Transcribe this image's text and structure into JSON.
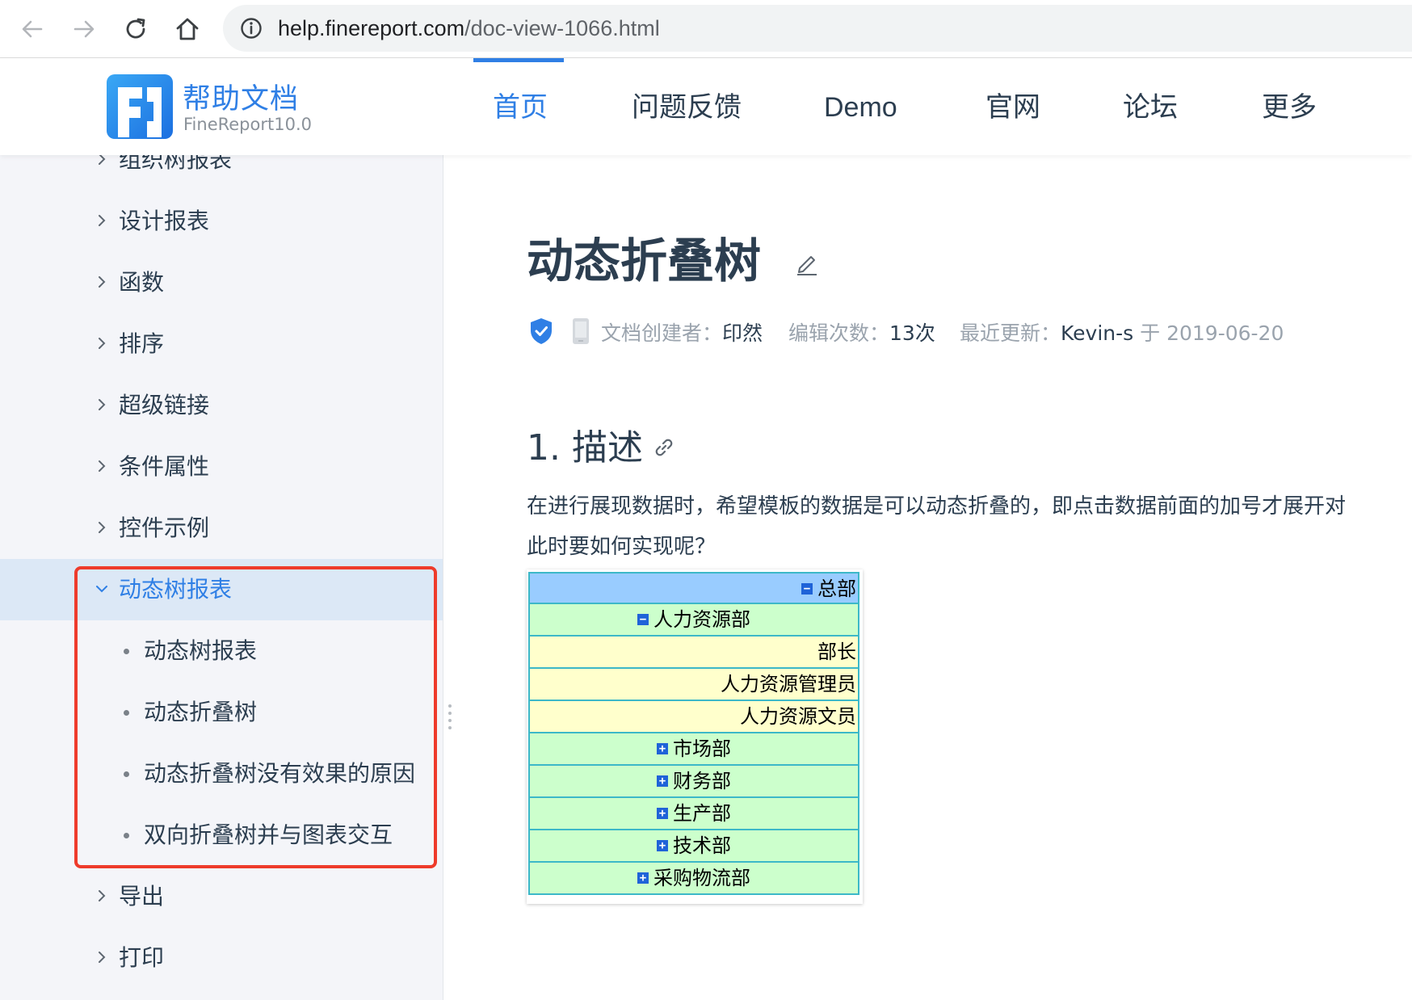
{
  "browser": {
    "url_host": "help.finereport.com",
    "url_path": "/doc-view-1066.html",
    "back_icon": "arrow-left-icon",
    "forward_icon": "arrow-right-icon",
    "reload_icon": "reload-icon",
    "home_icon": "home-icon",
    "info_icon": "info-circle-icon"
  },
  "header": {
    "logo_title": "帮助文档",
    "logo_subtitle": "FineReport10.0",
    "nav": [
      {
        "label": "首页",
        "active": true
      },
      {
        "label": "问题反馈"
      },
      {
        "label": "Demo"
      },
      {
        "label": "官网"
      },
      {
        "label": "论坛"
      },
      {
        "label": "更多"
      }
    ],
    "accent_color": "#2f7fe5"
  },
  "sidebar": {
    "items": [
      {
        "label": "组织树报表"
      },
      {
        "label": "设计报表"
      },
      {
        "label": "函数"
      },
      {
        "label": "排序"
      },
      {
        "label": "超级链接"
      },
      {
        "label": "条件属性"
      },
      {
        "label": "控件示例"
      },
      {
        "label": "动态树报表",
        "expanded": true,
        "active": true
      },
      {
        "label": "导出"
      },
      {
        "label": "打印"
      }
    ],
    "sub_items": [
      {
        "label": "动态树报表"
      },
      {
        "label": "动态折叠树"
      },
      {
        "label": "动态折叠树没有效果的原因"
      },
      {
        "label": "双向折叠树并与图表交互"
      }
    ],
    "highlight_color": "#ee3b2b"
  },
  "doc": {
    "title": "动态折叠树",
    "meta": {
      "creator_label": "文档创建者：",
      "creator": "印然",
      "edits_label": "编辑次数：",
      "edits": "13次",
      "updated_label": "最近更新：",
      "updated_by": "Kevin-s",
      "updated_on_label": " 于 2019-06-20"
    },
    "section1_heading": "1. 描述",
    "paragraph_line1": "在进行展现数据时，希望模板的数据是可以动态折叠的，即点击数据前面的加号才展开对",
    "paragraph_line2": "此时要如何实现呢？"
  },
  "tree_demo": {
    "rows": [
      {
        "text": "总部",
        "toggle": "−",
        "bg": "#99ccff",
        "align": "right"
      },
      {
        "text": "人力资源部",
        "toggle": "−",
        "bg": "#ccffcc",
        "align": "center"
      },
      {
        "text": "部长",
        "toggle": "",
        "bg": "#ffffcc",
        "align": "right"
      },
      {
        "text": "人力资源管理员",
        "toggle": "",
        "bg": "#ffffcc",
        "align": "right"
      },
      {
        "text": "人力资源文员",
        "toggle": "",
        "bg": "#ffffcc",
        "align": "right"
      },
      {
        "text": "市场部",
        "toggle": "+",
        "bg": "#ccffcc",
        "align": "center"
      },
      {
        "text": "财务部",
        "toggle": "+",
        "bg": "#ccffcc",
        "align": "center"
      },
      {
        "text": "生产部",
        "toggle": "+",
        "bg": "#ccffcc",
        "align": "center"
      },
      {
        "text": "技术部",
        "toggle": "+",
        "bg": "#ccffcc",
        "align": "center"
      },
      {
        "text": "采购物流部",
        "toggle": "+",
        "bg": "#ccffcc",
        "align": "center"
      }
    ]
  }
}
